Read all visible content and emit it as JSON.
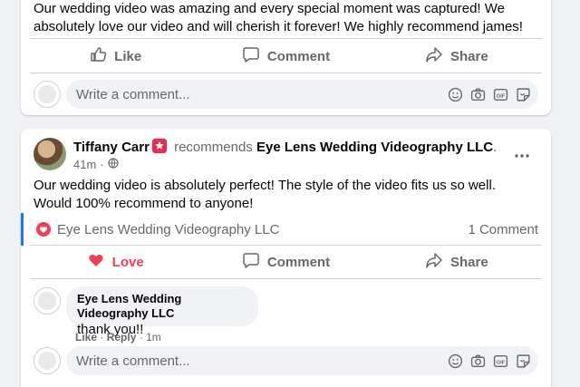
{
  "post1": {
    "text": "Our wedding video was amazing and every special moment was captured! We absolutely love our video and will cherish it forever! We highly recommend james!",
    "actions": {
      "like": "Like",
      "comment": "Comment",
      "share": "Share"
    },
    "write_placeholder": "Write a comment..."
  },
  "post2": {
    "author": "Tiffany Carr",
    "verb": "recommends",
    "page": "Eye Lens Wedding Videography LLC",
    "period": ".",
    "time": "41m",
    "text": "Our wedding video is absolutely perfect! The style of the video fits us so well. Would 100% recommend to anyone!",
    "recommendation_page": "Eye Lens Wedding Videography LLC",
    "comment_count": "1 Comment",
    "actions": {
      "love": "Love",
      "comment": "Comment",
      "share": "Share"
    },
    "reply": {
      "name": "Eye Lens Wedding Videography LLC",
      "text": "thank you!!",
      "like": "Like",
      "sep": "·",
      "reply": "Reply",
      "time": "1m"
    },
    "write_placeholder": "Write a comment..."
  },
  "colors": {
    "love": "#f33e58",
    "accent": "#1877f2",
    "muted": "#65676b"
  },
  "icons": [
    "thumbs-up-icon",
    "comment-icon",
    "share-icon",
    "heart-icon",
    "globe-icon",
    "more-icon",
    "emoji-icon",
    "camera-icon",
    "gif-icon",
    "sticker-icon",
    "star-badge-icon"
  ]
}
